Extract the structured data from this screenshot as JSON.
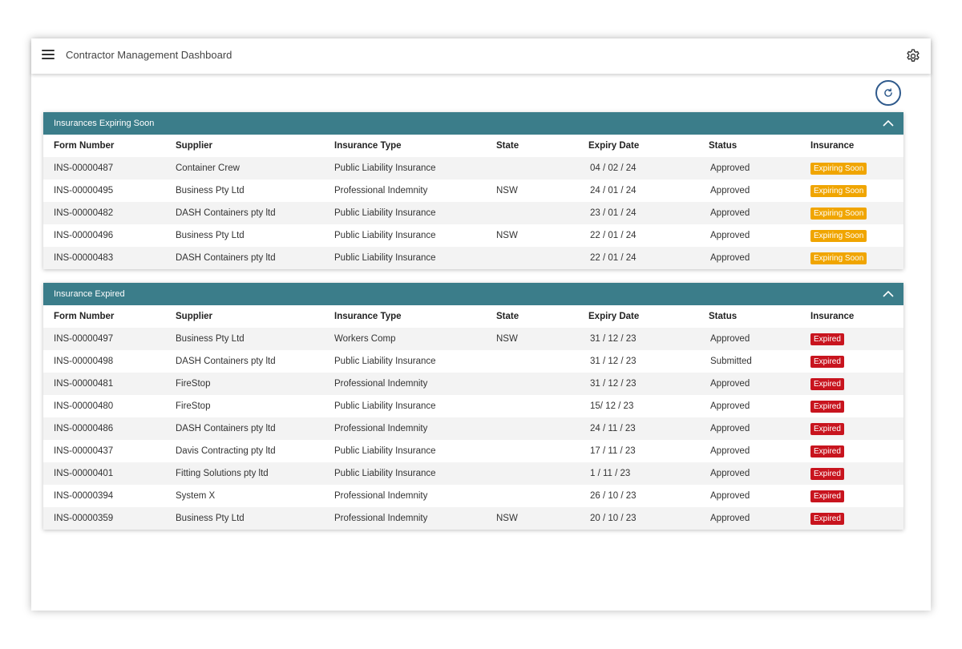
{
  "header": {
    "title": "Contractor Management Dashboard"
  },
  "colors": {
    "panel_header": "#3b7d8a",
    "expiring_badge": "#f0a500",
    "expired_badge": "#c8141e",
    "refresh_ring": "#2f5a8c"
  },
  "icons": {
    "menu": "hamburger-menu-icon",
    "settings": "gear-icon",
    "refresh": "refresh-icon",
    "collapse": "chevron-up-icon"
  },
  "columns": [
    "Form Number",
    "Supplier",
    "Insurance Type",
    "State",
    "Expiry Date",
    "Status",
    "Insurance"
  ],
  "expiring": {
    "title": "Insurances Expiring Soon",
    "rows": [
      {
        "form": "INS-00000487",
        "supplier": "Container Crew",
        "type": "Public Liability Insurance",
        "state": "",
        "expiry": "04 / 02 / 24",
        "status": "Approved",
        "insurance": "Expiring Soon"
      },
      {
        "form": "INS-00000495",
        "supplier": "Business Pty Ltd",
        "type": "Professional Indemnity",
        "state": "NSW",
        "expiry": "24 / 01 / 24",
        "status": "Approved",
        "insurance": "Expiring Soon"
      },
      {
        "form": "INS-00000482",
        "supplier": "DASH Containers pty ltd",
        "type": "Public Liability Insurance",
        "state": "",
        "expiry": "23 / 01 / 24",
        "status": "Approved",
        "insurance": "Expiring Soon"
      },
      {
        "form": "INS-00000496",
        "supplier": "Business Pty Ltd",
        "type": "Public Liability Insurance",
        "state": "NSW",
        "expiry": "22 / 01 / 24",
        "status": "Approved",
        "insurance": "Expiring Soon"
      },
      {
        "form": "INS-00000483",
        "supplier": "DASH Containers pty ltd",
        "type": "Public Liability Insurance",
        "state": "",
        "expiry": "22 / 01 / 24",
        "status": "Approved",
        "insurance": "Expiring Soon"
      }
    ]
  },
  "expired": {
    "title": "Insurance Expired",
    "rows": [
      {
        "form": "INS-00000497",
        "supplier": "Business Pty Ltd",
        "type": "Workers Comp",
        "state": "NSW",
        "expiry": "31 / 12 / 23",
        "status": "Approved",
        "insurance": "Expired"
      },
      {
        "form": "INS-00000498",
        "supplier": "DASH Containers pty ltd",
        "type": "Public Liability Insurance",
        "state": "",
        "expiry": "31 / 12 / 23",
        "status": "Submitted",
        "insurance": "Expired"
      },
      {
        "form": "INS-00000481",
        "supplier": "FireStop",
        "type": "Professional Indemnity",
        "state": "",
        "expiry": "31 / 12 / 23",
        "status": "Approved",
        "insurance": "Expired"
      },
      {
        "form": "INS-00000480",
        "supplier": "FireStop",
        "type": "Public Liability Insurance",
        "state": "",
        "expiry": "15/ 12 / 23",
        "status": "Approved",
        "insurance": "Expired"
      },
      {
        "form": "INS-00000486",
        "supplier": "DASH Containers pty ltd",
        "type": "Professional Indemnity",
        "state": "",
        "expiry": "24 / 11 / 23",
        "status": "Approved",
        "insurance": "Expired"
      },
      {
        "form": "INS-00000437",
        "supplier": "Davis Contracting pty ltd",
        "type": "Public Liability Insurance",
        "state": "",
        "expiry": "17 / 11 / 23",
        "status": "Approved",
        "insurance": "Expired"
      },
      {
        "form": "INS-00000401",
        "supplier": "Fitting Solutions pty ltd",
        "type": "Public Liability Insurance",
        "state": "",
        "expiry": "1 / 11 / 23",
        "status": "Approved",
        "insurance": "Expired"
      },
      {
        "form": "INS-00000394",
        "supplier": "System X",
        "type": "Professional Indemnity",
        "state": "",
        "expiry": "26 / 10 / 23",
        "status": "Approved",
        "insurance": "Expired"
      },
      {
        "form": "INS-00000359",
        "supplier": "Business Pty Ltd",
        "type": "Professional Indemnity",
        "state": "NSW",
        "expiry": "20 / 10 / 23",
        "status": "Approved",
        "insurance": "Expired"
      }
    ]
  }
}
